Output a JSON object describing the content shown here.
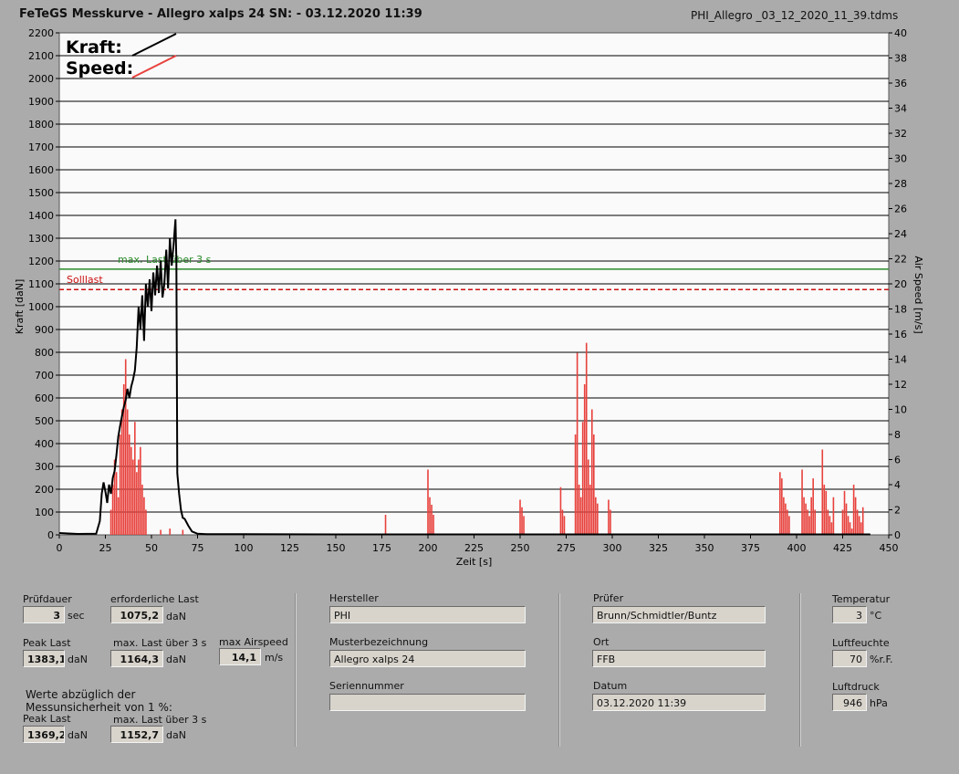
{
  "header": {
    "title": "FeTeGS Messkurve - Allegro xalps 24  SN:  - 03.12.2020 11:39",
    "filename": "PHI_Allegro _03_12_2020_11_39.tdms"
  },
  "colors": {
    "kraft": "#000000",
    "speed": "#e8413c",
    "max_last": "#2a8a2a",
    "solllast": "#cc1111",
    "plot_bg": "#fafafa"
  },
  "chart_data": {
    "type": "line",
    "xlabel": "Zeit [s]",
    "ylabel": "Kraft [daN]",
    "y2label": "Air Speed [m/s]",
    "xlim": [
      0,
      450
    ],
    "ylim": [
      0,
      2200
    ],
    "y2lim": [
      0,
      40
    ],
    "xticks": [
      0,
      25,
      50,
      75,
      100,
      125,
      150,
      175,
      200,
      225,
      250,
      275,
      300,
      325,
      350,
      375,
      400,
      425,
      450
    ],
    "yticks": [
      0,
      100,
      200,
      300,
      400,
      500,
      600,
      700,
      800,
      900,
      1000,
      1100,
      1200,
      1300,
      1400,
      1500,
      1600,
      1700,
      1800,
      1900,
      2000,
      2100,
      2200
    ],
    "y2ticks": [
      0,
      2,
      4,
      6,
      8,
      10,
      12,
      14,
      16,
      18,
      20,
      22,
      24,
      26,
      28,
      30,
      32,
      34,
      36,
      38,
      40
    ],
    "grid": true,
    "legend": [
      "Kraft:",
      "Speed:"
    ],
    "legend_position": "top-left",
    "ref_lines": [
      {
        "name": "max. Last über  3 s",
        "y": 1164.3,
        "style": "solid"
      },
      {
        "name": "Solllast",
        "y": 1075.2,
        "style": "dashed"
      }
    ],
    "series": [
      {
        "name": "Kraft",
        "axis": "left",
        "x": [
          0,
          5,
          10,
          20,
          22,
          23,
          24,
          25,
          26,
          27,
          28,
          29,
          30,
          31,
          32,
          33,
          34,
          35,
          36,
          37,
          38,
          39,
          40,
          41,
          42,
          43,
          44,
          45,
          46,
          47,
          48,
          49,
          50,
          51,
          52,
          53,
          54,
          55,
          56,
          57,
          58,
          59,
          60,
          61,
          62,
          63,
          63.5,
          64,
          65,
          66,
          67,
          68,
          70,
          72,
          75,
          80,
          100,
          150,
          200,
          250,
          300,
          350,
          400,
          440
        ],
        "y": [
          8,
          6,
          4,
          5,
          60,
          180,
          230,
          190,
          140,
          220,
          180,
          250,
          280,
          350,
          430,
          480,
          520,
          560,
          590,
          640,
          600,
          650,
          680,
          720,
          820,
          1000,
          900,
          1050,
          850,
          1100,
          1000,
          1120,
          980,
          1150,
          1050,
          1180,
          1060,
          1200,
          1040,
          1100,
          1250,
          1080,
          1300,
          1180,
          1270,
          1383,
          1200,
          270,
          180,
          110,
          75,
          70,
          40,
          15,
          5,
          3,
          3,
          2,
          2,
          2,
          2,
          2,
          2,
          2
        ]
      },
      {
        "name": "Speed",
        "axis": "right",
        "x": [
          28,
          29,
          30,
          31,
          32,
          33,
          34,
          35,
          36,
          37,
          38,
          39,
          40,
          41,
          42,
          43,
          44,
          45,
          46,
          47,
          55,
          60,
          67,
          177,
          200,
          201,
          202,
          203,
          250,
          251,
          252,
          272,
          273,
          274,
          280,
          281,
          282,
          283,
          284,
          285,
          286,
          287,
          288,
          289,
          290,
          291,
          292,
          298,
          299,
          391,
          392,
          393,
          394,
          395,
          396,
          403,
          404,
          405,
          406,
          407,
          408,
          409,
          410,
          414,
          415,
          416,
          417,
          418,
          419,
          420,
          425,
          426,
          427,
          428,
          429,
          430,
          431,
          432,
          433,
          434,
          435,
          436
        ],
        "y": [
          2,
          4,
          6,
          5,
          3,
          8,
          10,
          12,
          14,
          10,
          8,
          7,
          6,
          9,
          5,
          6,
          7,
          4,
          3,
          2,
          0.4,
          0.5,
          0.4,
          1.6,
          5.2,
          3,
          2.4,
          1.6,
          2.8,
          2.2,
          1.5,
          3.8,
          2,
          1.5,
          8,
          14.5,
          4,
          3,
          9,
          12,
          15.3,
          6,
          4,
          10,
          8,
          3,
          2.5,
          2.8,
          2,
          5,
          4.5,
          3,
          2.5,
          2,
          1.5,
          5.2,
          3,
          2.5,
          2,
          1.5,
          3,
          4.5,
          2,
          6.8,
          4,
          3.5,
          2,
          1.5,
          1,
          3,
          2,
          3.5,
          2.5,
          1.5,
          1,
          0.5,
          4,
          3,
          2,
          1.5,
          1,
          2.2
        ]
      }
    ]
  },
  "fields": {
    "pruefdauer": {
      "label": "Prüfdauer",
      "value": "3",
      "unit": "sec"
    },
    "erf_last": {
      "label": "erforderliche Last",
      "value": "1075,2",
      "unit": "daN"
    },
    "peak_last": {
      "label": "Peak Last",
      "value": "1383,1",
      "unit": "daN"
    },
    "max_last": {
      "label": "max. Last über  3 s",
      "value": "1164,3",
      "unit": "daN"
    },
    "max_airspeed": {
      "label": "max Airspeed",
      "value": "14,1",
      "unit": "m/s"
    },
    "werte_note_1": "Werte abzüglich der",
    "werte_note_2": "Messunsicherheit von 1  %:",
    "peak_last_2": {
      "label": "Peak Last",
      "value": "1369,2",
      "unit": "daN"
    },
    "max_last_2": {
      "label": "max. Last über  3 s",
      "value": "1152,7",
      "unit": "daN"
    },
    "hersteller": {
      "label": "Hersteller",
      "value": "PHI"
    },
    "muster": {
      "label": "Musterbezeichnung",
      "value": "Allegro xalps 24"
    },
    "seriennummer": {
      "label": "Seriennummer",
      "value": ""
    },
    "pruefer": {
      "label": "Prüfer",
      "value": "Brunn/Schmidtler/Buntz"
    },
    "ort": {
      "label": "Ort",
      "value": "FFB"
    },
    "datum": {
      "label": "Datum",
      "value": "03.12.2020 11:39"
    },
    "temperatur": {
      "label": "Temperatur",
      "value": "3",
      "unit": "°C"
    },
    "luftfeuchte": {
      "label": "Luftfeuchte",
      "value": "70",
      "unit": "%r.F."
    },
    "luftdruck": {
      "label": "Luftdruck",
      "value": "946",
      "unit": "hPa"
    }
  }
}
